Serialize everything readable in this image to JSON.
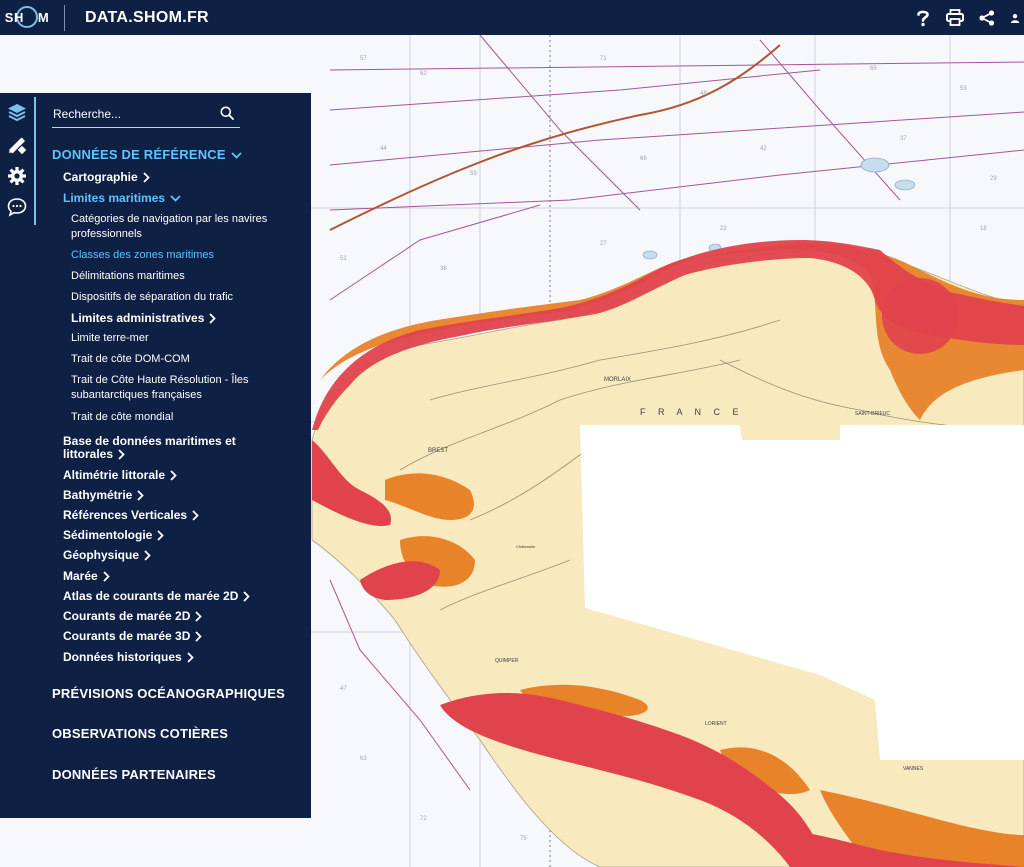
{
  "header": {
    "logo_text_left": "SH",
    "logo_text_right": "M",
    "title": "DATA.SHOM.FR",
    "tools": [
      "help-icon",
      "print-icon",
      "share-icon",
      "user-icon"
    ]
  },
  "iconbar": {
    "icons": [
      "layers-icon",
      "draw-tools-icon",
      "settings-icon",
      "chat-icon"
    ]
  },
  "search": {
    "placeholder": "Recherche..."
  },
  "menu": {
    "section_reference": "DONNÉES DE RÉFÉRENCE",
    "cartographie": "Cartographie",
    "limites_maritimes": "Limites maritimes",
    "sub": {
      "categories_line1": "Catégories de navigation par les navires",
      "categories_line2": "professionnels",
      "classes_zones": "Classes des zones maritimes",
      "delimitations": "Délimitations maritimes",
      "dispositifs": "Dispositifs de séparation du trafic",
      "limites_admin": "Limites administratives",
      "limite_terre_mer": "Limite terre-mer",
      "trait_dom_com": "Trait de côte DOM-COM",
      "trait_hr_line1": "Trait de Côte Haute Résolution - Îles",
      "trait_hr_line2": "subantarctiques françaises",
      "trait_mondial": "Trait de côte mondial"
    },
    "base_line1": "Base de données maritimes et",
    "base_line2": "littorales",
    "altimetrie": "Altimétrie littorale",
    "bathymetrie": "Bathymétrie",
    "references_verticales": "Références Verticales",
    "sedimentologie": "Sédimentologie",
    "geophysique": "Géophysique",
    "maree": "Marée",
    "atlas_courants": "Atlas de courants de marée 2D",
    "courants_2d": "Courants de marée 2D",
    "courants_3d": "Courants de marée 3D",
    "donnees_historiques": "Données historiques",
    "section_previsions": "PRÉVISIONS OCÉANOGRAPHIQUES",
    "section_observations": "OBSERVATIONS COTIÈRES",
    "section_partenaires": "DONNÉES PARTENAIRES"
  },
  "map": {
    "label_country": "F R A N C E",
    "label_brest": "BREST",
    "label_morlaix": "MORLAIX",
    "label_saint_brieuc": "SAINT-BRIEUC",
    "label_quimper": "QUIMPER",
    "label_lorient": "LORIENT",
    "label_vannes": "VANNES",
    "label_chateaulin": "Châteaulin",
    "colors": {
      "sea": "#f6f8fc",
      "land": "#f8e9be",
      "zone_red": "#e0434c",
      "zone_orange": "#e8832a",
      "route_line": "#a8539a",
      "header": "#0f2045",
      "accent": "#5fc3ff"
    }
  }
}
